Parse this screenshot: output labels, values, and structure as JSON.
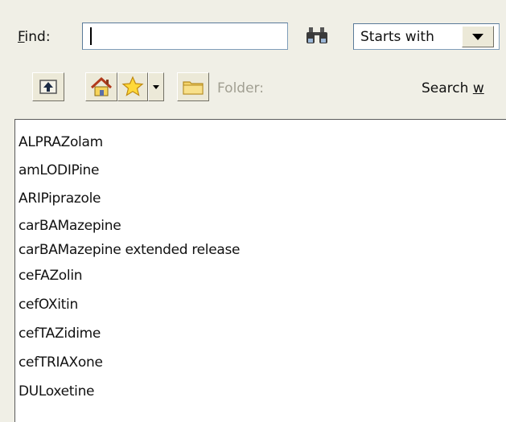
{
  "find": {
    "label_hotkey": "F",
    "label_rest": "ind:",
    "value": "",
    "search_icon": "binoculars-icon"
  },
  "match_mode": {
    "selected": "Starts with",
    "icon": "chevron-down-icon"
  },
  "toolbar": {
    "up_icon": "up-folder-icon",
    "home_icon": "home-icon",
    "favorites_icon": "star-icon",
    "favorites_dropdown_icon": "chevron-down-icon",
    "folder_icon": "folder-icon",
    "folder_label": "Folder:",
    "search_within_prefix": "Search ",
    "search_within_hotkey": "w"
  },
  "results": [
    "ALPRAZolam",
    "amLODIPine",
    "ARIPiprazole",
    "carBAMazepine",
    "carBAMazepine extended release",
    "ceFAZolin",
    "cefOXitin",
    "cefTAZidime",
    "cefTRIAXone",
    "DULoxetine"
  ],
  "colors": {
    "window_bg": "#f0efe6",
    "field_border": "#7f9db9",
    "disabled_text": "#a19f92"
  }
}
